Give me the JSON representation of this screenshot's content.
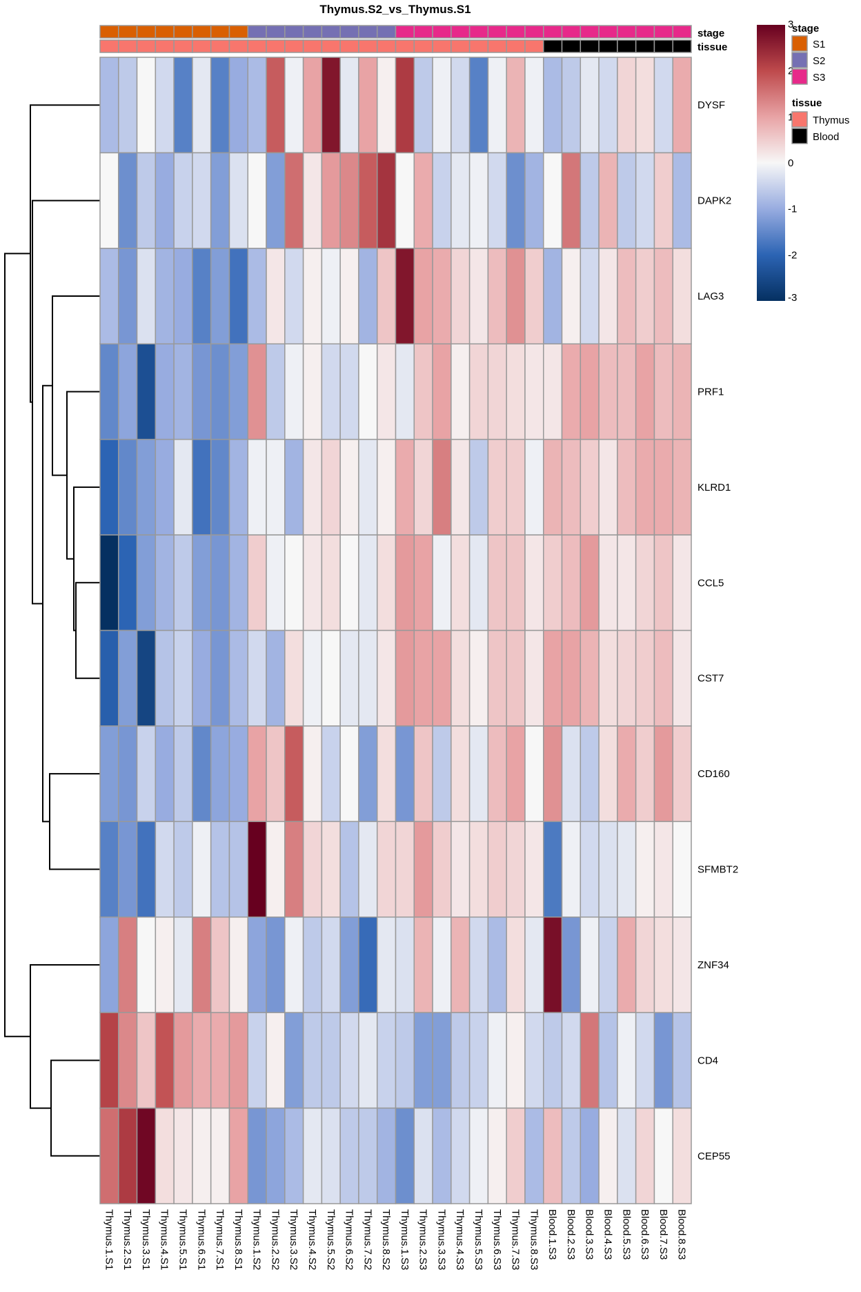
{
  "chart_data": {
    "type": "heatmap",
    "title": "Thymus.S2_vs_Thymus.S1",
    "color_scale": {
      "min": -3,
      "max": 3,
      "ticks": [
        "3",
        "2",
        "1",
        "0",
        "-1",
        "-2",
        "-3"
      ],
      "tick_values": [
        3,
        2,
        1,
        0,
        -1,
        -2,
        -3
      ],
      "low_color": "#053061",
      "mid_color": "#f7f7f7",
      "high_color": "#67001f"
    },
    "columns": [
      "Thymus.1.S1",
      "Thymus.2.S1",
      "Thymus.3.S1",
      "Thymus.4.S1",
      "Thymus.5.S1",
      "Thymus.6.S1",
      "Thymus.7.S1",
      "Thymus.8.S1",
      "Thymus.1.S2",
      "Thymus.2.S2",
      "Thymus.3.S2",
      "Thymus.4.S2",
      "Thymus.5.S2",
      "Thymus.6.S2",
      "Thymus.7.S2",
      "Thymus.8.S2",
      "Thymus.1.S3",
      "Thymus.2.S3",
      "Thymus.3.S3",
      "Thymus.4.S3",
      "Thymus.5.S3",
      "Thymus.6.S3",
      "Thymus.7.S3",
      "Thymus.8.S3",
      "Blood.1.S3",
      "Blood.2.S3",
      "Blood.3.S3",
      "Blood.4.S3",
      "Blood.5.S3",
      "Blood.6.S3",
      "Blood.7.S3",
      "Blood.8.S3"
    ],
    "rows": [
      "DYSF",
      "DAPK2",
      "LAG3",
      "PRF1",
      "KLRD1",
      "CCL5",
      "CST7",
      "CD160",
      "SFMBT2",
      "ZNF34",
      "CD4",
      "CEP55"
    ],
    "values": [
      [
        -0.8,
        -0.6,
        0.0,
        -0.4,
        -1.6,
        -0.2,
        -1.6,
        -1.0,
        -0.8,
        1.8,
        -0.1,
        1.0,
        2.7,
        -0.2,
        1.0,
        0.1,
        2.2,
        -0.6,
        -0.1,
        -0.4,
        -1.6,
        -0.1,
        0.8,
        -0.1,
        -0.8,
        -0.6,
        -0.2,
        -0.4,
        0.4,
        0.3,
        -0.4,
        0.9
      ],
      [
        0.0,
        -1.4,
        -0.6,
        -1.0,
        -0.5,
        -0.4,
        -1.2,
        -0.3,
        0.0,
        -1.2,
        1.6,
        0.2,
        1.1,
        1.3,
        1.8,
        2.3,
        0.0,
        0.9,
        -0.5,
        -0.2,
        -0.1,
        -0.4,
        -1.4,
        -0.9,
        0.0,
        1.5,
        -0.6,
        0.8,
        -0.6,
        -0.4,
        0.5,
        -0.8
      ],
      [
        -0.8,
        -1.3,
        -0.3,
        -0.9,
        -1.0,
        -1.6,
        -1.2,
        -1.8,
        -0.8,
        0.2,
        -0.4,
        0.1,
        -0.1,
        0.1,
        -0.9,
        0.6,
        2.7,
        1.0,
        0.9,
        0.4,
        0.2,
        0.7,
        1.2,
        0.5,
        -0.9,
        0.1,
        -0.4,
        0.2,
        0.7,
        0.5,
        0.7,
        0.3
      ],
      [
        -1.5,
        -1.1,
        -2.4,
        -1.0,
        -0.9,
        -1.3,
        -1.4,
        -1.2,
        1.2,
        -0.6,
        -0.1,
        0.1,
        -0.4,
        -0.4,
        0.0,
        0.2,
        -0.2,
        0.6,
        1.0,
        0.1,
        0.4,
        0.4,
        0.3,
        0.2,
        0.2,
        0.9,
        1.0,
        0.7,
        0.7,
        1.0,
        0.7,
        0.8
      ],
      [
        -2.0,
        -1.5,
        -1.2,
        -1.0,
        -0.2,
        -1.8,
        -1.5,
        -0.9,
        -0.1,
        -0.1,
        -0.9,
        0.2,
        0.4,
        0.1,
        -0.2,
        0.1,
        0.9,
        0.4,
        1.4,
        0.2,
        -0.6,
        0.5,
        0.5,
        -0.1,
        0.8,
        0.7,
        0.5,
        0.2,
        0.7,
        0.9,
        0.9,
        0.8
      ],
      [
        -3.0,
        -2.0,
        -1.2,
        -0.9,
        -0.6,
        -1.2,
        -1.3,
        -0.9,
        0.5,
        -0.1,
        0.0,
        0.2,
        0.3,
        0.0,
        -0.2,
        0.3,
        1.1,
        1.0,
        -0.1,
        0.3,
        -0.2,
        0.6,
        0.6,
        0.2,
        0.5,
        0.7,
        1.1,
        0.2,
        0.2,
        0.4,
        0.6,
        0.2
      ],
      [
        -2.1,
        -1.2,
        -2.6,
        -0.7,
        -0.5,
        -1.0,
        -1.3,
        -0.8,
        -0.4,
        -0.9,
        0.3,
        -0.1,
        0.0,
        -0.2,
        -0.2,
        0.2,
        1.1,
        1.0,
        1.0,
        0.3,
        0.1,
        0.6,
        0.6,
        0.2,
        1.0,
        1.0,
        0.8,
        0.3,
        0.4,
        0.5,
        0.7,
        0.2
      ],
      [
        -1.2,
        -1.3,
        -0.5,
        -1.0,
        -0.6,
        -1.5,
        -1.1,
        -1.0,
        1.0,
        0.6,
        1.8,
        0.1,
        -0.5,
        0.0,
        -1.2,
        0.3,
        -1.3,
        0.6,
        -0.6,
        0.3,
        -0.2,
        0.7,
        1.0,
        0.0,
        1.2,
        -0.3,
        -0.6,
        0.3,
        0.9,
        0.5,
        1.1,
        0.5
      ],
      [
        -1.6,
        -1.3,
        -1.8,
        -0.4,
        -0.6,
        -0.1,
        -0.7,
        -0.7,
        3.0,
        0.1,
        1.4,
        0.4,
        0.3,
        -0.7,
        -0.2,
        0.4,
        0.4,
        1.1,
        0.5,
        0.2,
        0.3,
        0.5,
        0.4,
        0.2,
        -1.7,
        -0.1,
        -0.4,
        -0.3,
        -0.2,
        0.1,
        0.2,
        0.0
      ],
      [
        -1.1,
        1.4,
        0.0,
        0.1,
        -0.2,
        1.4,
        0.6,
        0.1,
        -1.1,
        -1.3,
        -0.1,
        -0.6,
        -0.4,
        -1.2,
        -1.9,
        -0.2,
        -0.3,
        0.8,
        -0.1,
        0.8,
        -0.4,
        -0.8,
        0.3,
        -0.2,
        2.8,
        -1.3,
        -0.1,
        -0.5,
        0.9,
        0.4,
        0.3,
        0.2
      ],
      [
        2.1,
        1.3,
        0.6,
        1.9,
        1.1,
        0.9,
        0.9,
        1.1,
        -0.5,
        0.1,
        -1.2,
        -0.6,
        -0.6,
        -0.4,
        -0.2,
        -0.5,
        -0.6,
        -1.2,
        -1.2,
        -0.6,
        -0.5,
        -0.1,
        0.1,
        -0.4,
        -0.6,
        -0.4,
        1.5,
        -0.7,
        -0.1,
        -0.4,
        -1.3,
        -0.7
      ],
      [
        1.6,
        2.2,
        2.9,
        0.3,
        0.2,
        0.1,
        0.1,
        1.0,
        -1.3,
        -1.1,
        -0.8,
        -0.2,
        -0.3,
        -0.6,
        -0.6,
        -0.9,
        -1.4,
        -0.3,
        -0.8,
        -0.4,
        -0.1,
        0.1,
        0.5,
        -0.8,
        0.7,
        -0.6,
        -1.0,
        0.1,
        -0.3,
        0.4,
        0.0,
        0.3
      ]
    ],
    "annotations": {
      "stage": {
        "label": "stage",
        "values": [
          "S1",
          "S1",
          "S1",
          "S1",
          "S1",
          "S1",
          "S1",
          "S1",
          "S2",
          "S2",
          "S2",
          "S2",
          "S2",
          "S2",
          "S2",
          "S2",
          "S3",
          "S3",
          "S3",
          "S3",
          "S3",
          "S3",
          "S3",
          "S3",
          "S3",
          "S3",
          "S3",
          "S3",
          "S3",
          "S3",
          "S3",
          "S3"
        ],
        "legend": [
          {
            "name": "S1",
            "color": "#d95f02"
          },
          {
            "name": "S2",
            "color": "#7570b3"
          },
          {
            "name": "S3",
            "color": "#e7298a"
          }
        ]
      },
      "tissue": {
        "label": "tissue",
        "values": [
          "Thymus",
          "Thymus",
          "Thymus",
          "Thymus",
          "Thymus",
          "Thymus",
          "Thymus",
          "Thymus",
          "Thymus",
          "Thymus",
          "Thymus",
          "Thymus",
          "Thymus",
          "Thymus",
          "Thymus",
          "Thymus",
          "Thymus",
          "Thymus",
          "Thymus",
          "Thymus",
          "Thymus",
          "Thymus",
          "Thymus",
          "Thymus",
          "Blood",
          "Blood",
          "Blood",
          "Blood",
          "Blood",
          "Blood",
          "Blood",
          "Blood"
        ],
        "legend": [
          {
            "name": "Thymus",
            "color": "#f8766d"
          },
          {
            "name": "Blood",
            "color": "#000000"
          }
        ]
      }
    },
    "row_dendrogram": {
      "merges": [
        [
          "CCL5",
          "CST7"
        ],
        [
          "KLRD1",
          "CCL5+CST7"
        ],
        [
          "PRF1",
          "KLRD1+CCL5+CST7"
        ],
        [
          "LAG3",
          "PRF1+KLRD1+CCL5+CST7"
        ],
        [
          "CD160",
          "SFMBT2"
        ],
        [
          "LAG3..CST7",
          "CD160+SFMBT2"
        ],
        [
          "DAPK2",
          "LAG3..SFMBT2"
        ],
        [
          "DYSF",
          "DAPK2..SFMBT2"
        ],
        [
          "CD4",
          "CEP55"
        ],
        [
          "ZNF34",
          "CD4+CEP55"
        ],
        [
          "DYSF..SFMBT2",
          "ZNF34+CD4+CEP55"
        ]
      ]
    },
    "grid_color": "#999999"
  }
}
